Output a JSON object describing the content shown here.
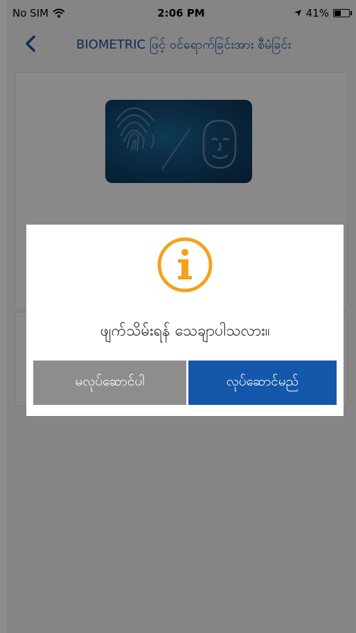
{
  "status_bar": {
    "carrier": "No SIM",
    "time": "2:06 PM",
    "battery": "41%",
    "battery_level": 0.41
  },
  "nav": {
    "title": "BIOMETRIC ဖြင့် ဝင်ရောက်ခြင်းအား စီမံခြင်း",
    "back_icon": "chevron-left-icon"
  },
  "dialog": {
    "icon": "info-icon",
    "message": "ဖျက်သိမ်းရန် သေချာပါသလား။",
    "cancel_label": "မလုပ်ဆောင်ပါ",
    "confirm_label": "လုပ်ဆောင်မည်"
  },
  "colors": {
    "brand": "#1557aa",
    "nav_title": "#1c4f9c",
    "cancel": "#8d8d8d",
    "info_accent": "#f4a11c"
  }
}
